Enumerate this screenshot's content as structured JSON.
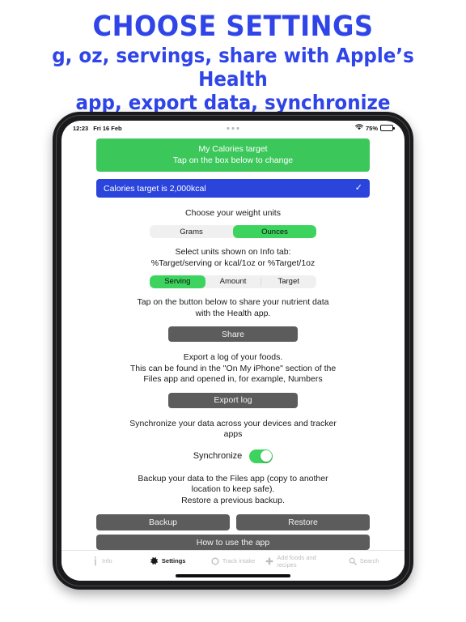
{
  "promo": {
    "line1": "CHOOSE SETTINGS",
    "line2": "g, oz, servings, share with Apple’s Health",
    "line3": "app, export data, synchronize",
    "color": "#2f45e8"
  },
  "status_bar": {
    "time": "12:23",
    "date": "Fri 16 Feb",
    "battery_percent": "75%",
    "wifi_icon": "wifi-icon",
    "battery_icon": "battery-icon",
    "multitask_icon": "multitask-dots-icon"
  },
  "settings": {
    "banner": {
      "title": "My Calories target",
      "subtitle": "Tap on the box below to change"
    },
    "target_row": {
      "label": "Calories target is 2,000kcal",
      "check_icon": "✓"
    },
    "weight_units": {
      "caption": "Choose your weight units",
      "options": [
        {
          "label": "Grams",
          "selected": false
        },
        {
          "label": "Ounces",
          "selected": true
        }
      ]
    },
    "info_units": {
      "caption_line1": "Select units shown on Info tab:",
      "caption_line2": "%Target/serving or kcal/1oz or %Target/1oz",
      "options": [
        {
          "label": "Serving",
          "selected": true
        },
        {
          "label": "Amount",
          "selected": false
        },
        {
          "label": "Target",
          "selected": false
        }
      ]
    },
    "share": {
      "caption_line1": "Tap on the button below to share your nutrient data",
      "caption_line2": "with the Health app.",
      "button": "Share"
    },
    "export": {
      "caption_line1": "Export a log of your foods.",
      "caption_line2": "This can be found in the \"On My iPhone\" section of the",
      "caption_line3": "Files app and opened in, for example, Numbers",
      "button": "Export log"
    },
    "synchronize": {
      "caption_line1": "Synchronize your data across your devices and tracker",
      "caption_line2": "apps",
      "label": "Synchronize",
      "enabled": true
    },
    "backup": {
      "caption_line1": "Backup your data to the Files app (copy to another",
      "caption_line2": "location to keep safe).",
      "caption_line3": "Restore a previous backup.",
      "backup_button": "Backup",
      "restore_button": "Restore",
      "help_button": "How to use the app"
    },
    "colors": {
      "green": "#3cc75b",
      "segment_green": "#3cd45e",
      "blue": "#2b44dc",
      "gray_button": "#5c5c5c",
      "segment_track": "#f0f0f0"
    }
  },
  "tabbar": {
    "items": [
      {
        "label": "Info",
        "icon": "info-icon",
        "active": false
      },
      {
        "label": "Settings",
        "icon": "gear-icon",
        "active": true
      },
      {
        "label": "Track intake",
        "icon": "circle-icon",
        "active": false
      },
      {
        "label": "Add foods and recipes",
        "icon": "plus-icon",
        "active": false
      },
      {
        "label": "Search",
        "icon": "search-icon",
        "active": false
      }
    ]
  }
}
